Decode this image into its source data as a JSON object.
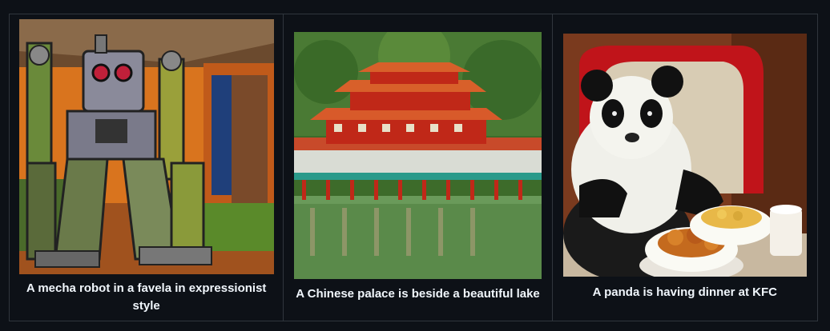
{
  "gallery": {
    "items": [
      {
        "caption": "A mecha robot in a favela in expressionist style"
      },
      {
        "caption": "A Chinese palace is beside a beautiful lake"
      },
      {
        "caption": "A panda is having dinner at KFC"
      }
    ]
  }
}
